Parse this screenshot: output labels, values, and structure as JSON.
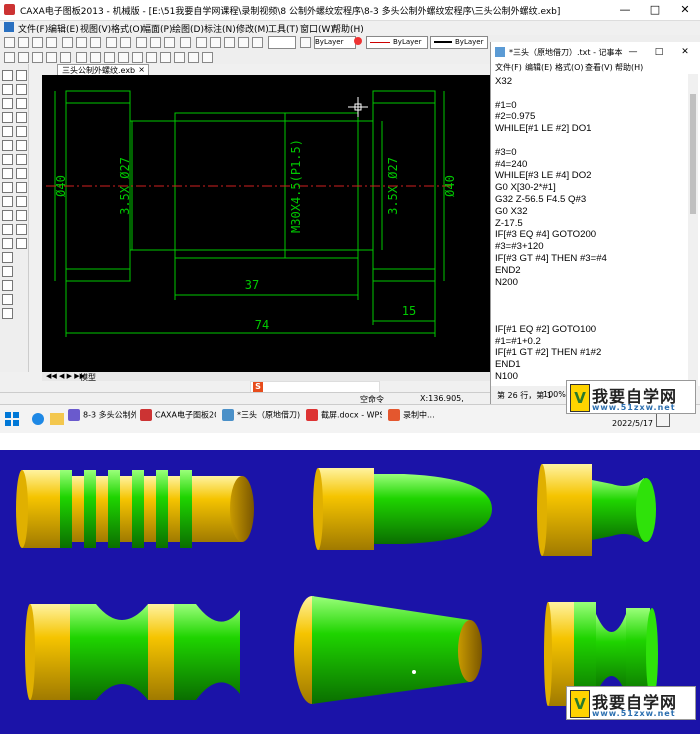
{
  "cad": {
    "title": "CAXA电子图板2013 - 机械版 - [E:\\51我要自学网课程\\录制视频\\8 公制外螺纹宏程序\\8-3 多头公制外螺纹宏程序\\三头公制外螺纹.exb]",
    "menus": [
      "文件(F)",
      "编辑(E)",
      "视图(V)",
      "格式(O)",
      "幅面(P)",
      "绘图(D)",
      "标注(N)",
      "修改(M)",
      "工具(T)",
      "窗口(W)",
      "帮助(H)"
    ],
    "layer_select": "ByLayer",
    "linetype_select": "ByLayer",
    "lineweight_select": "ByLayer",
    "doc_tab": "三头公制外螺纹.exb",
    "model_tab": "模型",
    "status_command": "空命令",
    "status_coords": "X:136.905, Y:14.292",
    "drawing": {
      "dim_74": "74",
      "dim_37": "37",
      "dim_15": "15",
      "dim_dia40_left": "Ø40",
      "dim_dia40_right": "Ø40",
      "dim_chamfer_left": "3.5X Ø27",
      "dim_chamfer_right": "3.5X Ø27",
      "dim_thread": "M30X4.5(P1.5)"
    }
  },
  "notepad": {
    "title": "*三头（原地借刀）.txt - 记事本",
    "menus": [
      "文件(F)",
      "编辑(E)",
      "格式(O)",
      "查看(V)",
      "帮助(H)"
    ],
    "lines": [
      "X32",
      "",
      "#1=0",
      "#2=0.975",
      "WHILE[#1 LE #2] DO1",
      "",
      "#3=0",
      "#4=240",
      "WHILE[#3 LE #4] DO2",
      "G0 X[30-2*#1]",
      "G32 Z-56.5 F4.5 Q#3",
      "G0 X32",
      "Z-17.5",
      "IF[#3 EQ #4] GOTO200",
      "#3=#3+120",
      "IF[#3 GT #4] THEN #3=#4",
      "END2",
      "N200",
      "",
      "",
      "",
      "IF[#1 EQ #2] GOTO100",
      "#1=#1+0.2",
      "IF[#1 GT #2] THEN #1#2",
      "END1",
      "N100"
    ],
    "status_pos": "第 26 行，第 1",
    "status_zoom": "100%"
  },
  "taskbar": {
    "items": [
      "8-3 多头公制外螺...",
      "CAXA电子图板20...",
      "*三头（原地借刀)...",
      "截屏.docx - WPS...",
      "录制中..."
    ],
    "time": "15:43",
    "date": "2022/5/17"
  },
  "watermark": {
    "brand": "我要自学网",
    "url": "www.51zxw.net"
  },
  "colors": {
    "part_yellow": "#f5c400",
    "part_green": "#1fd400",
    "panel_blue": "#1b13a8",
    "cad_green": "#00c800",
    "cad_red": "#d02020"
  }
}
